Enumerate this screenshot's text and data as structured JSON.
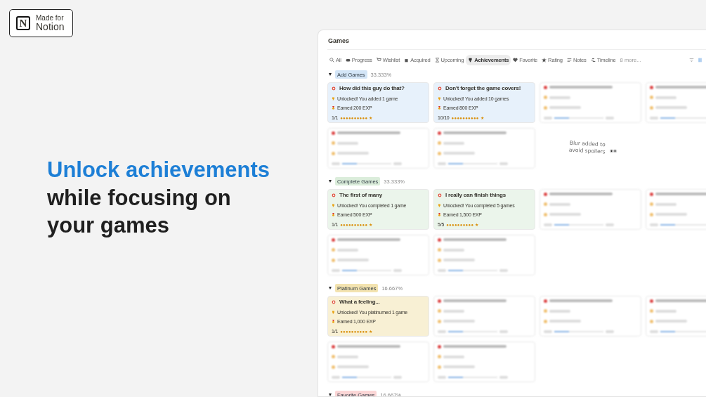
{
  "badge": {
    "logo_letter": "N",
    "line1": "Made for",
    "line2": "Notion"
  },
  "headline": {
    "highlight": "Unlock achievements",
    "rest": "while focusing on your games"
  },
  "window": {
    "title": "Games",
    "tabs": [
      {
        "label": "All",
        "selected": false
      },
      {
        "label": "Progress",
        "selected": false
      },
      {
        "label": "Wishlist",
        "selected": false
      },
      {
        "label": "Acquired",
        "selected": false
      },
      {
        "label": "Upcoming",
        "selected": false
      },
      {
        "label": "Achievements",
        "selected": true
      },
      {
        "label": "Favorite",
        "selected": false
      },
      {
        "label": "Rating",
        "selected": false
      },
      {
        "label": "Notes",
        "selected": false
      },
      {
        "label": "Timeline",
        "selected": false
      }
    ],
    "more_views": "8 more...",
    "note": "Blur added to avoid spoilers",
    "groups": [
      {
        "label": "Add Games",
        "percent": "33.333%",
        "color": "#d3e5f7",
        "expanded": true,
        "cards": [
          {
            "kind": "unlocked",
            "title": "How did this guy do that?",
            "unlocked": "Unlocked! You added 1 game",
            "earned": "Earned 200 EXP",
            "count": "1/1",
            "bar": "●●●●●●●●●● ★"
          },
          {
            "kind": "unlocked",
            "title": "Don't forget the game covers!",
            "unlocked": "Unlocked! You added 10 games",
            "earned": "Earned 800 EXP",
            "count": "10/10",
            "bar": "●●●●●●●●●● ★"
          },
          {
            "kind": "blurred"
          },
          {
            "kind": "blurred"
          },
          {
            "kind": "blurred"
          },
          {
            "kind": "blurred"
          }
        ]
      },
      {
        "label": "Complete Games",
        "percent": "33.333%",
        "color": "#dbeddb",
        "expanded": true,
        "cards": [
          {
            "kind": "unlocked",
            "title": "The first of many",
            "unlocked": "Unlocked! You completed 1 game",
            "earned": "Earned 500 EXP",
            "count": "1/1",
            "bar": "●●●●●●●●●● ★"
          },
          {
            "kind": "unlocked",
            "title": "I really can finish things",
            "unlocked": "Unlocked! You completed 5 games",
            "earned": "Earned 1,500 EXP",
            "count": "5/5",
            "bar": "●●●●●●●●●● ★"
          },
          {
            "kind": "blurred"
          },
          {
            "kind": "blurred"
          },
          {
            "kind": "blurred"
          },
          {
            "kind": "blurred"
          }
        ]
      },
      {
        "label": "Platinum Games",
        "percent": "16.667%",
        "color": "#f3e3b0",
        "expanded": true,
        "cards": [
          {
            "kind": "unlocked",
            "title": "What a feeling...",
            "unlocked": "Unlocked! You platinumed 1 game",
            "earned": "Earned 1,000 EXP",
            "count": "1/1",
            "bar": "●●●●●●●●●● ★"
          },
          {
            "kind": "blurred"
          },
          {
            "kind": "blurred"
          },
          {
            "kind": "blurred"
          },
          {
            "kind": "blurred"
          },
          {
            "kind": "blurred"
          }
        ]
      },
      {
        "label": "Favorite Games",
        "percent": "16.667%",
        "color": "#fbd6d6",
        "expanded": true
      }
    ]
  }
}
